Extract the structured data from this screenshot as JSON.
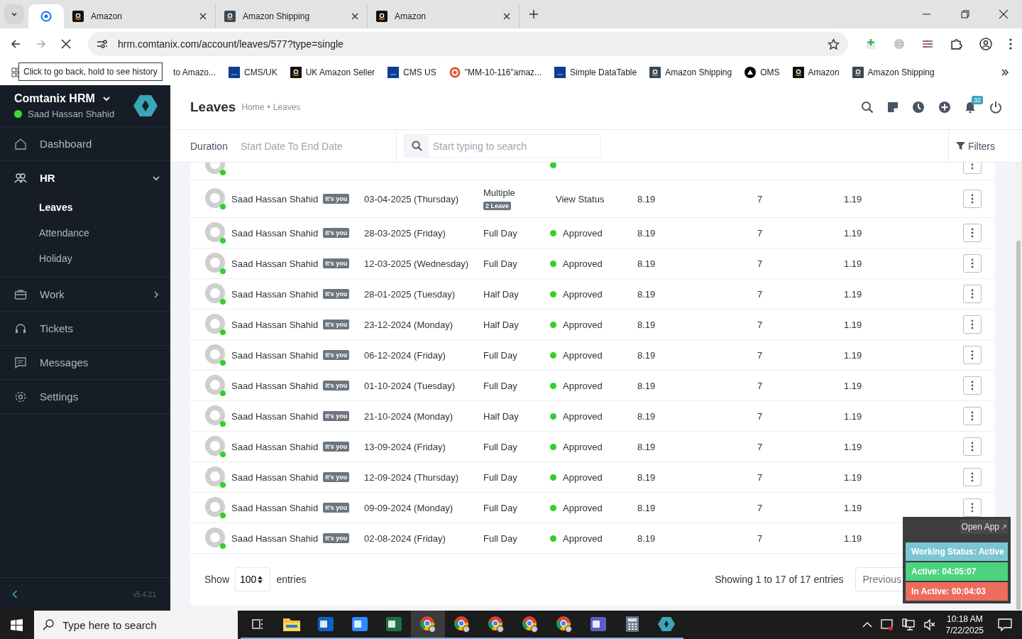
{
  "browser": {
    "tabs": [
      {
        "kind": "app",
        "selected": true
      },
      {
        "kind": "store",
        "title": "Amazon",
        "selected": false
      },
      {
        "kind": "store-alt",
        "title": "Amazon Shipping",
        "selected": false
      },
      {
        "kind": "store",
        "title": "Amazon",
        "selected": false
      }
    ],
    "url": "hrm.comtanix.com/account/leaves/577?type=single",
    "tooltip": "Click to go back, hold to see history",
    "bookmarks": [
      {
        "kind": "none",
        "title": "to Amazo..."
      },
      {
        "kind": "df",
        "title": "CMS/UK"
      },
      {
        "kind": "store",
        "title": "UK Amazon Seller"
      },
      {
        "kind": "df",
        "title": "CMS US"
      },
      {
        "kind": "duck",
        "title": "\"MM-10-116\"amaz..."
      },
      {
        "kind": "df",
        "title": "Simple DataTable"
      },
      {
        "kind": "store-alt",
        "title": "Amazon Shipping"
      },
      {
        "kind": "oms",
        "title": "OMS"
      },
      {
        "kind": "store",
        "title": "Amazon"
      },
      {
        "kind": "store-alt",
        "title": "Amazon Shipping"
      }
    ]
  },
  "sidebar": {
    "brand": "Comtanix HRM",
    "user": "Saad Hassan Shahid",
    "online": true,
    "version": "v5.4.21",
    "items": [
      {
        "kind": "home",
        "label": "Dashboard"
      },
      {
        "kind": "people",
        "label": "HR",
        "expanded": true,
        "children": [
          {
            "label": "Leaves",
            "selected": true
          },
          {
            "label": "Attendance",
            "selected": false
          },
          {
            "label": "Holiday",
            "selected": false
          }
        ]
      },
      {
        "kind": "briefcase",
        "label": "Work",
        "expanded": false
      },
      {
        "kind": "headset",
        "label": "Tickets"
      },
      {
        "kind": "chat",
        "label": "Messages"
      },
      {
        "kind": "gear",
        "label": "Settings"
      }
    ]
  },
  "page": {
    "title": "Leaves",
    "breadcrumb": [
      "Home",
      "Leaves"
    ],
    "breadcrumb_separator": "•",
    "notifications": "32"
  },
  "filters": {
    "duration_label": "Duration",
    "duration_placeholder": "Start Date To End Date",
    "search_placeholder": "Start typing to search",
    "filters_button": "Filters"
  },
  "table": {
    "rows": [
      {
        "kind": "approved"
      },
      {
        "kind": "link",
        "name": "Saad Hassan Shahid",
        "badge": "It's you",
        "date": "03-04-2025 (Thursday)",
        "type": "Multiple",
        "type_badge": "2 Leave",
        "status": "View Status",
        "values": [
          "8.19",
          "7",
          "1.19"
        ]
      },
      {
        "kind": "approved",
        "name": "Saad Hassan Shahid",
        "badge": "It's you",
        "date": "28-03-2025 (Friday)",
        "type": "Full Day",
        "status": "Approved",
        "values": [
          "8.19",
          "7",
          "1.19"
        ]
      },
      {
        "kind": "approved",
        "name": "Saad Hassan Shahid",
        "badge": "It's you",
        "date": "12-03-2025 (Wednesday)",
        "type": "Full Day",
        "status": "Approved",
        "values": [
          "8.19",
          "7",
          "1.19"
        ]
      },
      {
        "kind": "approved",
        "name": "Saad Hassan Shahid",
        "badge": "It's you",
        "date": "28-01-2025 (Tuesday)",
        "type": "Half Day",
        "status": "Approved",
        "values": [
          "8.19",
          "7",
          "1.19"
        ]
      },
      {
        "kind": "approved",
        "name": "Saad Hassan Shahid",
        "badge": "It's you",
        "date": "23-12-2024 (Monday)",
        "type": "Half Day",
        "status": "Approved",
        "values": [
          "8.19",
          "7",
          "1.19"
        ]
      },
      {
        "kind": "approved",
        "name": "Saad Hassan Shahid",
        "badge": "It's you",
        "date": "06-12-2024 (Friday)",
        "type": "Full Day",
        "status": "Approved",
        "values": [
          "8.19",
          "7",
          "1.19"
        ]
      },
      {
        "kind": "approved",
        "name": "Saad Hassan Shahid",
        "badge": "It's you",
        "date": "01-10-2024 (Tuesday)",
        "type": "Full Day",
        "status": "Approved",
        "values": [
          "8.19",
          "7",
          "1.19"
        ]
      },
      {
        "kind": "approved",
        "name": "Saad Hassan Shahid",
        "badge": "It's you",
        "date": "21-10-2024 (Monday)",
        "type": "Half Day",
        "status": "Approved",
        "values": [
          "8.19",
          "7",
          "1.19"
        ]
      },
      {
        "kind": "approved",
        "name": "Saad Hassan Shahid",
        "badge": "It's you",
        "date": "13-09-2024 (Friday)",
        "type": "Full Day",
        "status": "Approved",
        "values": [
          "8.19",
          "7",
          "1.19"
        ]
      },
      {
        "kind": "approved",
        "name": "Saad Hassan Shahid",
        "badge": "It's you",
        "date": "12-09-2024 (Thursday)",
        "type": "Full Day",
        "status": "Approved",
        "values": [
          "8.19",
          "7",
          "1.19"
        ]
      },
      {
        "kind": "approved",
        "name": "Saad Hassan Shahid",
        "badge": "It's you",
        "date": "09-09-2024 (Monday)",
        "type": "Full Day",
        "status": "Approved",
        "values": [
          "8.19",
          "7",
          "1.19"
        ]
      },
      {
        "kind": "approved",
        "name": "Saad Hassan Shahid",
        "badge": "It's you",
        "date": "02-08-2024 (Friday)",
        "type": "Full Day",
        "status": "Approved",
        "values": [
          "8.19",
          "7",
          "1.19"
        ]
      }
    ]
  },
  "footer": {
    "show_label": "Show",
    "page_size": "100",
    "entries_label": "entries",
    "summary": "Showing 1 to 17 of 17 entries",
    "previous": "Previous"
  },
  "widget": {
    "open_app": "Open App",
    "status": "Working Status: Active",
    "active": "Active: 04:05:07",
    "inactive": "In Active: 00:04:03"
  },
  "taskbar": {
    "search_placeholder": "Type here to search",
    "time": "10:18 AM",
    "date": "7/22/2025",
    "apps": [
      {
        "kind": "taskview",
        "selected": false
      },
      {
        "kind": "folder",
        "selected": false
      },
      {
        "kind": "mail",
        "selected": false
      },
      {
        "kind": "video",
        "selected": false
      },
      {
        "kind": "sheet",
        "selected": false
      },
      {
        "kind": "browser",
        "selected": true
      },
      {
        "kind": "browser",
        "selected": false
      },
      {
        "kind": "browser",
        "selected": false
      },
      {
        "kind": "browser",
        "selected": false
      },
      {
        "kind": "browser",
        "selected": false
      },
      {
        "kind": "team",
        "selected": false
      },
      {
        "kind": "calc",
        "selected": false
      },
      {
        "kind": "hrm",
        "selected": false
      }
    ]
  }
}
